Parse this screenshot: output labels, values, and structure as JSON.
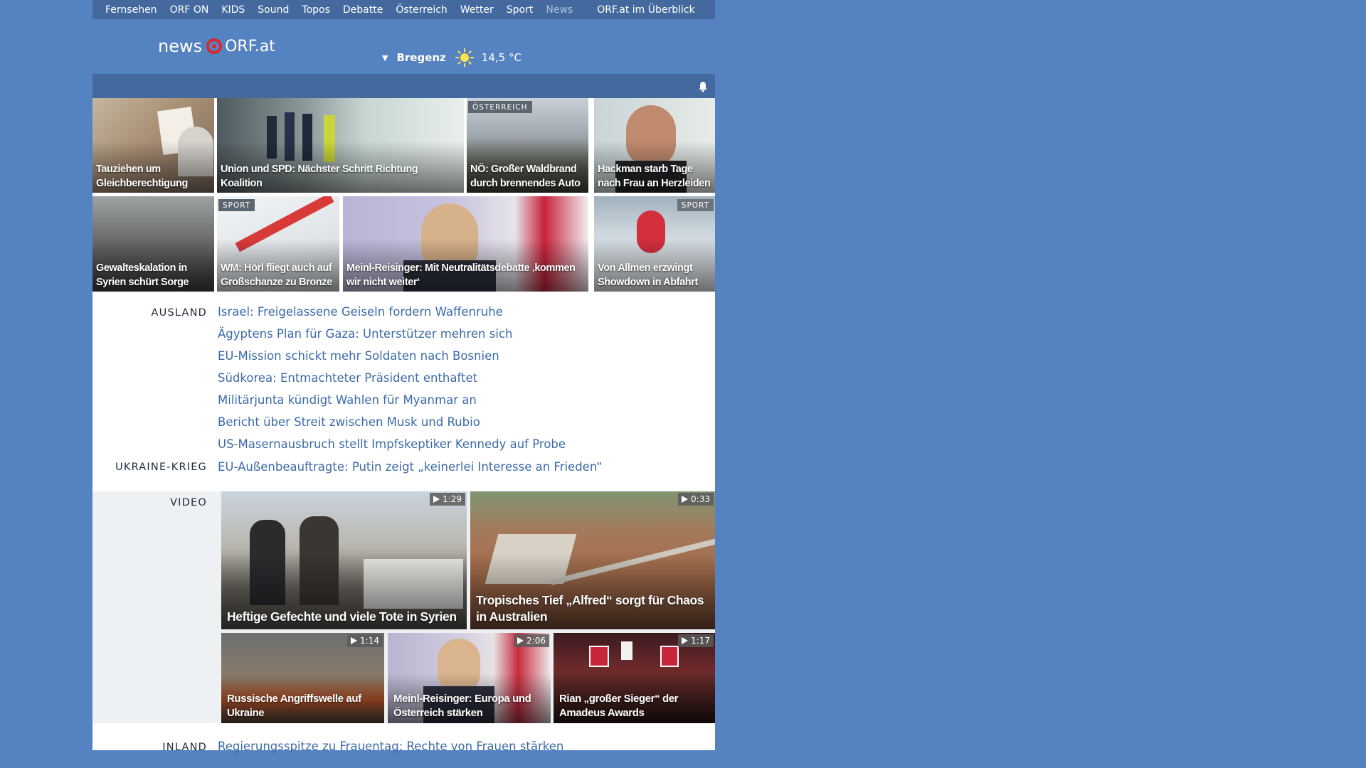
{
  "nav": {
    "items": [
      "Fernsehen",
      "ORF ON",
      "KIDS",
      "Sound",
      "Topos",
      "Debatte",
      "Österreich",
      "Wetter",
      "Sport",
      "News"
    ],
    "overview": "ORF.at im Überblick"
  },
  "header": {
    "logo_news": "news",
    "logo_orf": "ORF.at",
    "weather_location": "Bregenz",
    "weather_temp": "14,5 °C",
    "weather_icon": "sun-icon"
  },
  "tiles": [
    {
      "title": "Tauziehen um Gleichberechtigung",
      "tag": ""
    },
    {
      "title": "Union und SPD: Nächster Schritt Richtung Koalition",
      "tag": ""
    },
    {
      "title": "NÖ: Großer Waldbrand durch brennendes Auto",
      "tag": "ÖSTERREICH"
    },
    {
      "title": "Hackman starb Tage nach Frau an Herzleiden",
      "tag": ""
    },
    {
      "title": "Gewalteskalation in Syrien schürt Sorge",
      "tag": ""
    },
    {
      "title": "WM: Hörl fliegt auch auf Großschanze zu Bronze",
      "tag": "SPORT"
    },
    {
      "title": "Meinl-Reisinger: Mit Neutralitätsdebatte ‚kommen wir nicht weiter‘",
      "tag": ""
    },
    {
      "title": "Von Allmen erzwingt Showdown in Abfahrt",
      "tag": "SPORT"
    }
  ],
  "ausland": {
    "label": "AUSLAND",
    "links": [
      "Israel: Freigelassene Geiseln fordern Waffenruhe",
      "Ägyptens Plan für Gaza: Unterstützer mehren sich",
      "EU-Mission schickt mehr Soldaten nach Bosnien",
      "Südkorea: Entmachteter Präsident enthaftet",
      "Militärjunta kündigt Wahlen für Myanmar an",
      "Bericht über Streit zwischen Musk und Rubio",
      "US-Masernausbruch stellt Impfskeptiker Kennedy auf Probe"
    ]
  },
  "ukraine": {
    "label": "UKRAINE-KRIEG",
    "links": [
      "EU-Außenbeauftragte: Putin zeigt „keinerlei Interesse an Frieden“"
    ]
  },
  "video": {
    "label": "VIDEO",
    "items": [
      {
        "title": "Heftige Gefechte und viele Tote in Syrien",
        "duration": "1:29"
      },
      {
        "title": "Tropisches Tief „Alfred“ sorgt für Chaos in Australien",
        "duration": "0:33"
      },
      {
        "title": "Russische Angriffswelle auf Ukraine",
        "duration": "1:14"
      },
      {
        "title": "Meinl-Reisinger: Europa und Österreich stärken",
        "duration": "2:06"
      },
      {
        "title": "Rian „großer Sieger“ der Amadeus Awards",
        "duration": "1:17"
      }
    ]
  },
  "inland": {
    "label": "INLAND",
    "links": [
      "Regierungsspitze zu Frauentag: Rechte von Frauen stärken"
    ]
  },
  "colors": {
    "page_bg": "#5582c0",
    "nav_bg": "#44699f",
    "link": "#3b6aa8",
    "logo_red": "#d9272e"
  }
}
